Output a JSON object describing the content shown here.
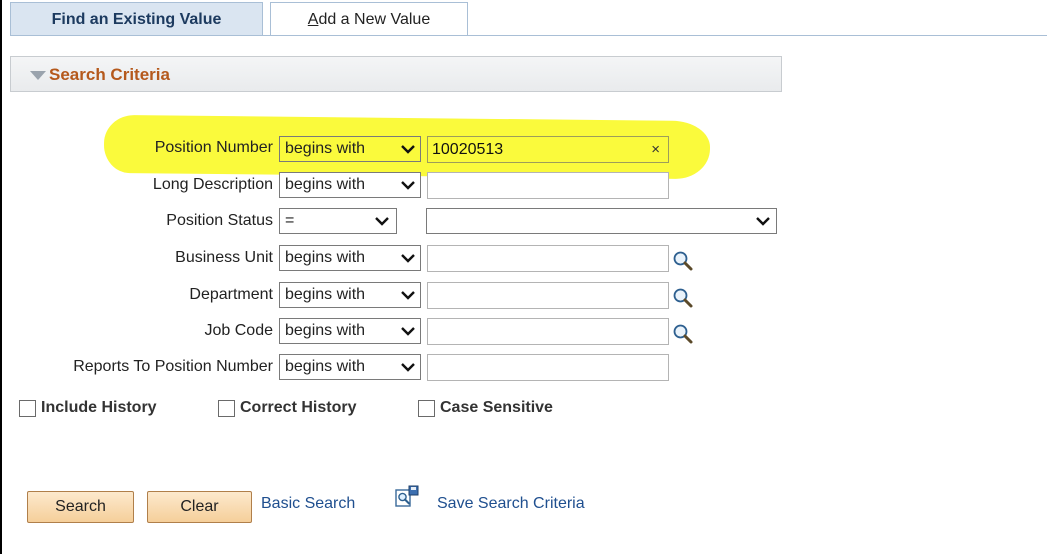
{
  "tabs": {
    "find_existing": "Find an Existing Value",
    "add_new": "Add a New Value",
    "add_new_accesskey": "A",
    "add_new_rest": "dd a New Value"
  },
  "section": {
    "title": "Search Criteria"
  },
  "fields": [
    {
      "label": "Position Number",
      "operator": "begins with",
      "value": "10020513"
    },
    {
      "label": "Long Description",
      "operator": "begins with",
      "value": ""
    },
    {
      "label": "Position Status",
      "operator": "=",
      "value": ""
    },
    {
      "label": "Business Unit",
      "operator": "begins with",
      "value": ""
    },
    {
      "label": "Department",
      "operator": "begins with",
      "value": ""
    },
    {
      "label": "Job Code",
      "operator": "begins with",
      "value": ""
    },
    {
      "label": "Reports To Position Number",
      "operator": "begins with",
      "value": ""
    }
  ],
  "clear_glyph": "×",
  "checkboxes": {
    "include_history": {
      "label": "Include History",
      "checked": false
    },
    "correct_history": {
      "label": "Correct History",
      "checked": false
    },
    "case_sensitive": {
      "label": "Case Sensitive",
      "checked": false
    }
  },
  "buttons": {
    "search": "Search",
    "clear": "Clear"
  },
  "links": {
    "basic_search": "Basic Search",
    "save_search_criteria": "Save Search Criteria"
  },
  "colors": {
    "highlight": "#fafa3c",
    "section_title": "#b5591c",
    "link": "#1f4f8f",
    "button": "#f5cf9a"
  },
  "icons": {
    "dropdown": "chevron-down-icon",
    "lookup": "magnifier-icon",
    "save_search": "save-search-icon"
  }
}
